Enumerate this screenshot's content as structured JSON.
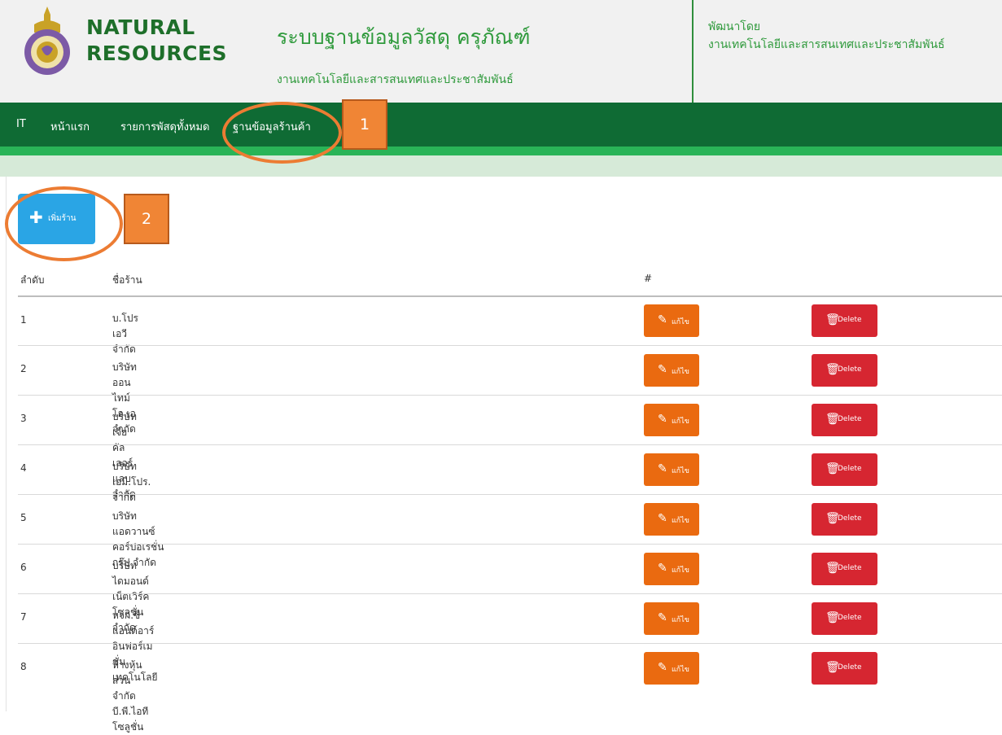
{
  "header": {
    "brand_line1": "NATURAL",
    "brand_line2": "RESOURCES",
    "title": "ระบบฐานข้อมูลวัสดุ ครุภัณฑ์",
    "subtitle": "งานเทคโนโลยีและสารสนเทศและประชาสัมพันธ์",
    "developed_by_label": "พัฒนาโดย",
    "developed_by": "งานเทคโนโลยีและสารสนเทศและประชาสัมพันธ์"
  },
  "nav": {
    "items": [
      "IT",
      "หน้าแรก",
      "รายการพัสดุทั้งหมด",
      "ฐานข้อมูลร้านค้า"
    ]
  },
  "annotations": [
    "1",
    "2"
  ],
  "toolbar": {
    "add_label": "เพิ่มร้าน",
    "add_icon": "plus-icon"
  },
  "table": {
    "headers": [
      "ลำดับ",
      "ชื่อร้าน",
      "#"
    ],
    "edit_label": "แก้ไข",
    "delete_label": "Delete",
    "rows": [
      {
        "num": "1",
        "name": "บ.โปร เอวี จำกัด"
      },
      {
        "num": "2",
        "name": "บริษัท ออนไทม์ โอ เอ จำกัด"
      },
      {
        "num": "3",
        "name": "บริษัท เจียคัลเลอร์แลบ จำกัด"
      },
      {
        "num": "4",
        "name": "บริษัท เอมิ.โปร. จำกัด"
      },
      {
        "num": "5",
        "name": "บริษัท แอดวานซ์ คอร์ปอเรชั่น กรุ๊ป จำกัด"
      },
      {
        "num": "6",
        "name": "บริษัท ไดมอนด์ เน็ตเวิร์ค โซลูชั่น จำกัด"
      },
      {
        "num": "7",
        "name": "หจก.ซีแอนด์อาร์ อินฟอร์เมชั่น เทคโนโลยี"
      },
      {
        "num": "8",
        "name": "ห้างหุ้นส่วนจำกัด บี.พี.ไอที โซลูชั่น"
      }
    ]
  },
  "colors": {
    "nav_bg": "#0f6b34",
    "accent_green": "#2f9a3c",
    "add_button": "#2aa5e5",
    "edit_button": "#ea6a10",
    "delete_button": "#d62631",
    "annotation": "#ec7c33"
  }
}
